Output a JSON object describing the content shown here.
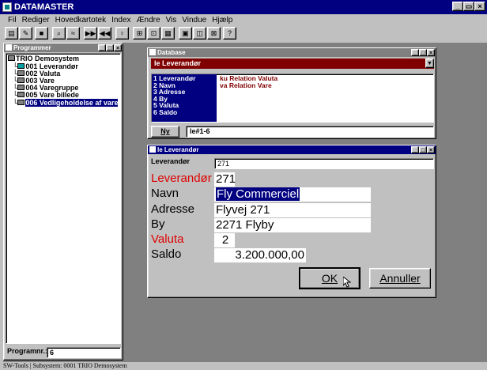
{
  "app": {
    "title": "DATAMASTER"
  },
  "menu": [
    "Fil",
    "Rediger",
    "Hovedkartotek",
    "Index",
    "Ændre",
    "Vis",
    "Vindue",
    "Hjælp"
  ],
  "toolbar": {
    "buttons": [
      "open-icon",
      "chart-icon",
      "save-icon",
      "find-icon",
      "filter-icon",
      "next-icon",
      "prev-icon",
      "bulb-icon",
      "table-icon",
      "form-icon",
      "layout-icon",
      "print-icon",
      "view-icon",
      "delete-icon",
      "help-icon"
    ]
  },
  "programmer": {
    "title": "Programmer",
    "tree": [
      {
        "label": "TRIO Demosystem",
        "level": 0
      },
      {
        "label": "001  Leverandør",
        "level": 1
      },
      {
        "label": "002  Valuta",
        "level": 1
      },
      {
        "label": "003  Vare",
        "level": 1
      },
      {
        "label": "004  Varegruppe",
        "level": 1
      },
      {
        "label": "005  Vare billede",
        "level": 1
      },
      {
        "label": "006  Vedligeholdelse af vare",
        "level": 1,
        "selected": true
      }
    ],
    "program_label": "Programnr.:",
    "program_value": "6"
  },
  "database": {
    "title": "Database",
    "combo": "le    Leverandør",
    "fields": [
      "1    Leverandør",
      "2    Navn",
      "3    Adresse",
      "4    By",
      "5    Valuta",
      "6    Saldo"
    ],
    "relations": [
      "ku  Relation Valuta",
      "va  Relation Vare"
    ],
    "new_button": "Ny",
    "expression": "le#1-6"
  },
  "form": {
    "title": "le Leverandør",
    "header_label": "Leverandør",
    "header_value": "271",
    "fields": {
      "leverandor": {
        "label": "Leverandør",
        "value": "271"
      },
      "navn": {
        "label": "Navn",
        "value": "Fly Commerciel"
      },
      "adresse": {
        "label": "Adresse",
        "value": "Flyvej 271"
      },
      "by": {
        "label": "By",
        "value": "2271 Flyby"
      },
      "valuta": {
        "label": "Valuta",
        "value": "2"
      },
      "saldo": {
        "label": "Saldo",
        "value": "3.200.000,00"
      }
    },
    "ok": "OK",
    "cancel": "Annuller"
  },
  "status": "SW-Tools | Subsystem: 0001 TRIO Demosystem",
  "colors": {
    "title_bar": "#000080",
    "key_label": "#e00000",
    "selection": "#000080",
    "relations": "#800000"
  }
}
